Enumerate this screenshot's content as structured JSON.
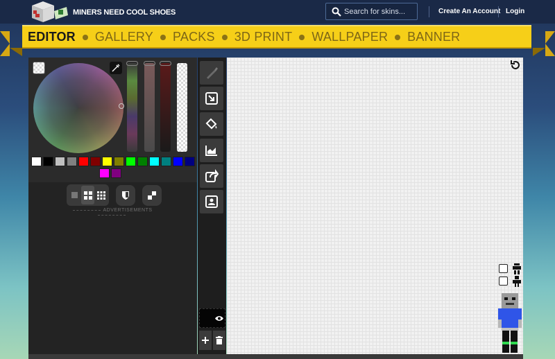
{
  "header": {
    "site_name": "MINERS NEED COOL SHOES",
    "search_placeholder": "Search for skins...",
    "create_account": "Create An Account",
    "login": "Login"
  },
  "nav": {
    "items": [
      {
        "label": "EDITOR",
        "active": true
      },
      {
        "label": "GALLERY",
        "active": false
      },
      {
        "label": "PACKS",
        "active": false
      },
      {
        "label": "3D PRINT",
        "active": false
      },
      {
        "label": "WALLPAPER",
        "active": false
      },
      {
        "label": "BANNER",
        "active": false
      }
    ]
  },
  "color_panel": {
    "palette": [
      "#ffffff",
      "#000000",
      "#c0c0c0",
      "#808080",
      "#ff0000",
      "#800000",
      "#ffff00",
      "#808000",
      "#00ff00",
      "#008000",
      "#00ffff",
      "#008080",
      "#0000ff",
      "#000080",
      "#ff00ff",
      "#800080"
    ],
    "advertisements_label": "ADVERTISEMENTS"
  },
  "toolbar": {
    "tools": [
      "brush-icon",
      "resize-icon",
      "paint-bucket-icon",
      "area-chart-icon",
      "share-icon",
      "portrait-icon"
    ]
  },
  "colors": {
    "ribbon": "#f6cf18",
    "topbar": "#1a2947",
    "panel": "#2b2b2b",
    "canvas": "#f1f1f1"
  }
}
